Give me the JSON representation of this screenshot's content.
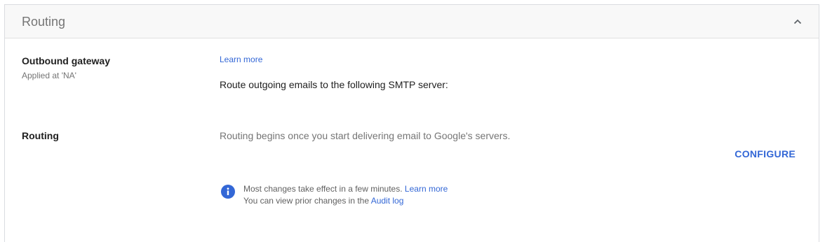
{
  "section": {
    "title": "Routing",
    "collapse_icon": "chevron-up-icon"
  },
  "outbound_gateway": {
    "label": "Outbound gateway",
    "applied_at": "Applied at 'NA'",
    "learn_more": "Learn more",
    "description": "Route outgoing emails to the following SMTP server:"
  },
  "routing": {
    "label": "Routing",
    "description": "Routing begins once you start delivering email to Google's servers.",
    "configure_label": "CONFIGURE"
  },
  "info": {
    "icon": "info-icon",
    "line1_text": "Most changes take effect in a few minutes.",
    "line1_link": "Learn more",
    "line2_text": "You can view prior changes in the",
    "line2_link": "Audit log"
  },
  "colors": {
    "accent": "#3367d6",
    "header_bg": "#f8f8f8"
  }
}
